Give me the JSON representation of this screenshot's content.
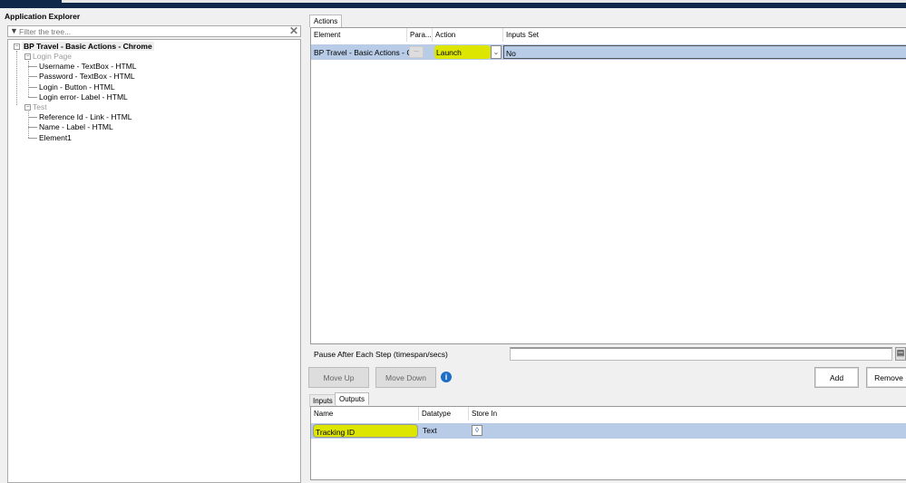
{
  "window": {
    "panel_title": "Application Explorer"
  },
  "explorer": {
    "filter_placeholder": "Filter the tree...",
    "root": "BP Travel - Basic Actions - Chrome",
    "groups": [
      {
        "label": "Login Page",
        "items": [
          "Username - TextBox - HTML",
          "Password - TextBox - HTML",
          "Login - Button - HTML",
          "Login error- Label - HTML"
        ]
      },
      {
        "label": "Test",
        "items": [
          "Reference Id - Link - HTML",
          "Name - Label - HTML",
          "Element1"
        ]
      }
    ]
  },
  "actions": {
    "tab": "Actions",
    "columns": [
      "Element",
      "Para...",
      "Action",
      "Inputs Set"
    ],
    "rows": [
      {
        "element": "BP Travel - Basic Actions - Chr",
        "params": "...",
        "action": "Launch",
        "inputs_set": "No"
      }
    ]
  },
  "pause": {
    "label": "Pause After Each Step (timespan/secs)",
    "value": ""
  },
  "buttons": {
    "move_up": "Move Up",
    "move_down": "Move Down",
    "add": "Add",
    "remove": "Remove"
  },
  "io": {
    "tabs": [
      "Inputs",
      "Outputs"
    ],
    "active_tab": "Outputs",
    "columns": [
      "Name",
      "Datatype",
      "Store In"
    ],
    "rows": [
      {
        "name": "Tracking ID",
        "datatype": "Text",
        "store_in": ""
      }
    ]
  },
  "colors": {
    "highlight": "#dde600",
    "selection": "#b8cce8",
    "topbar": "#10284a"
  }
}
